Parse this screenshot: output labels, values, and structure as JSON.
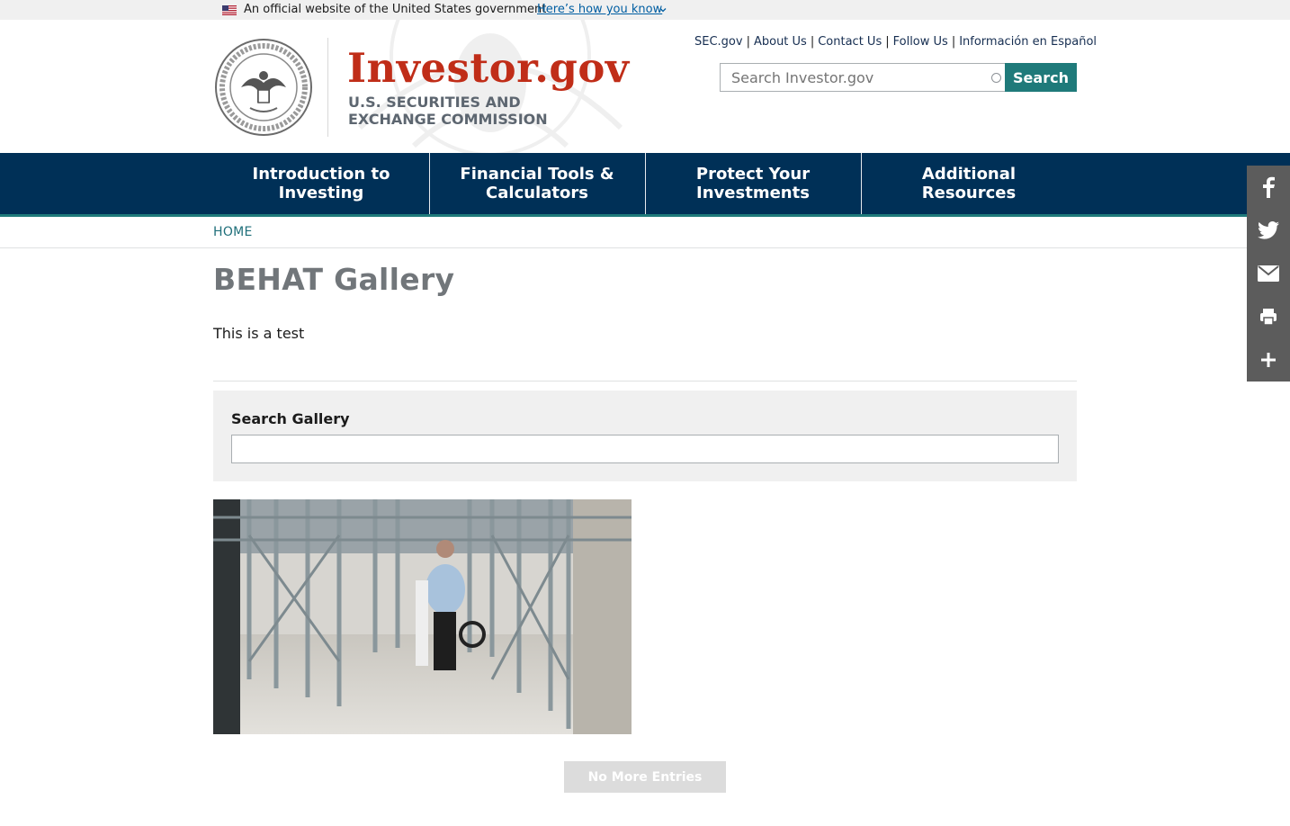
{
  "gov_banner": {
    "official_text": "An official website of the United States government",
    "how_link": "Here’s how you know"
  },
  "header": {
    "brand": "Investor.gov",
    "subtitle_line1": "U.S. SECURITIES AND",
    "subtitle_line2": "EXCHANGE COMMISSION",
    "utility_links": [
      "SEC.gov",
      "About Us",
      "Contact Us",
      "Follow Us",
      "Información en Español"
    ],
    "search": {
      "placeholder": "Search Investor.gov",
      "button": "Search"
    }
  },
  "nav": {
    "items": [
      {
        "line1": "Introduction to",
        "line2": "Investing"
      },
      {
        "line1": "Financial Tools &",
        "line2": "Calculators"
      },
      {
        "line1": "Protect Your",
        "line2": "Investments"
      },
      {
        "line1": "Additional",
        "line2": "Resources"
      }
    ]
  },
  "breadcrumb": {
    "home": "HOME"
  },
  "page": {
    "title": "BEHAT Gallery",
    "intro": "This is a test",
    "search_gallery_label": "Search Gallery",
    "load_more": "No More Entries"
  },
  "share_rail": {
    "icons": [
      "facebook-icon",
      "twitter-icon",
      "email-icon",
      "print-icon",
      "plus-icon"
    ]
  },
  "colors": {
    "brand_red": "#c02d18",
    "nav_blue": "#003057",
    "teal": "#1f7a7a",
    "rail_gray": "#5c5c5c"
  }
}
